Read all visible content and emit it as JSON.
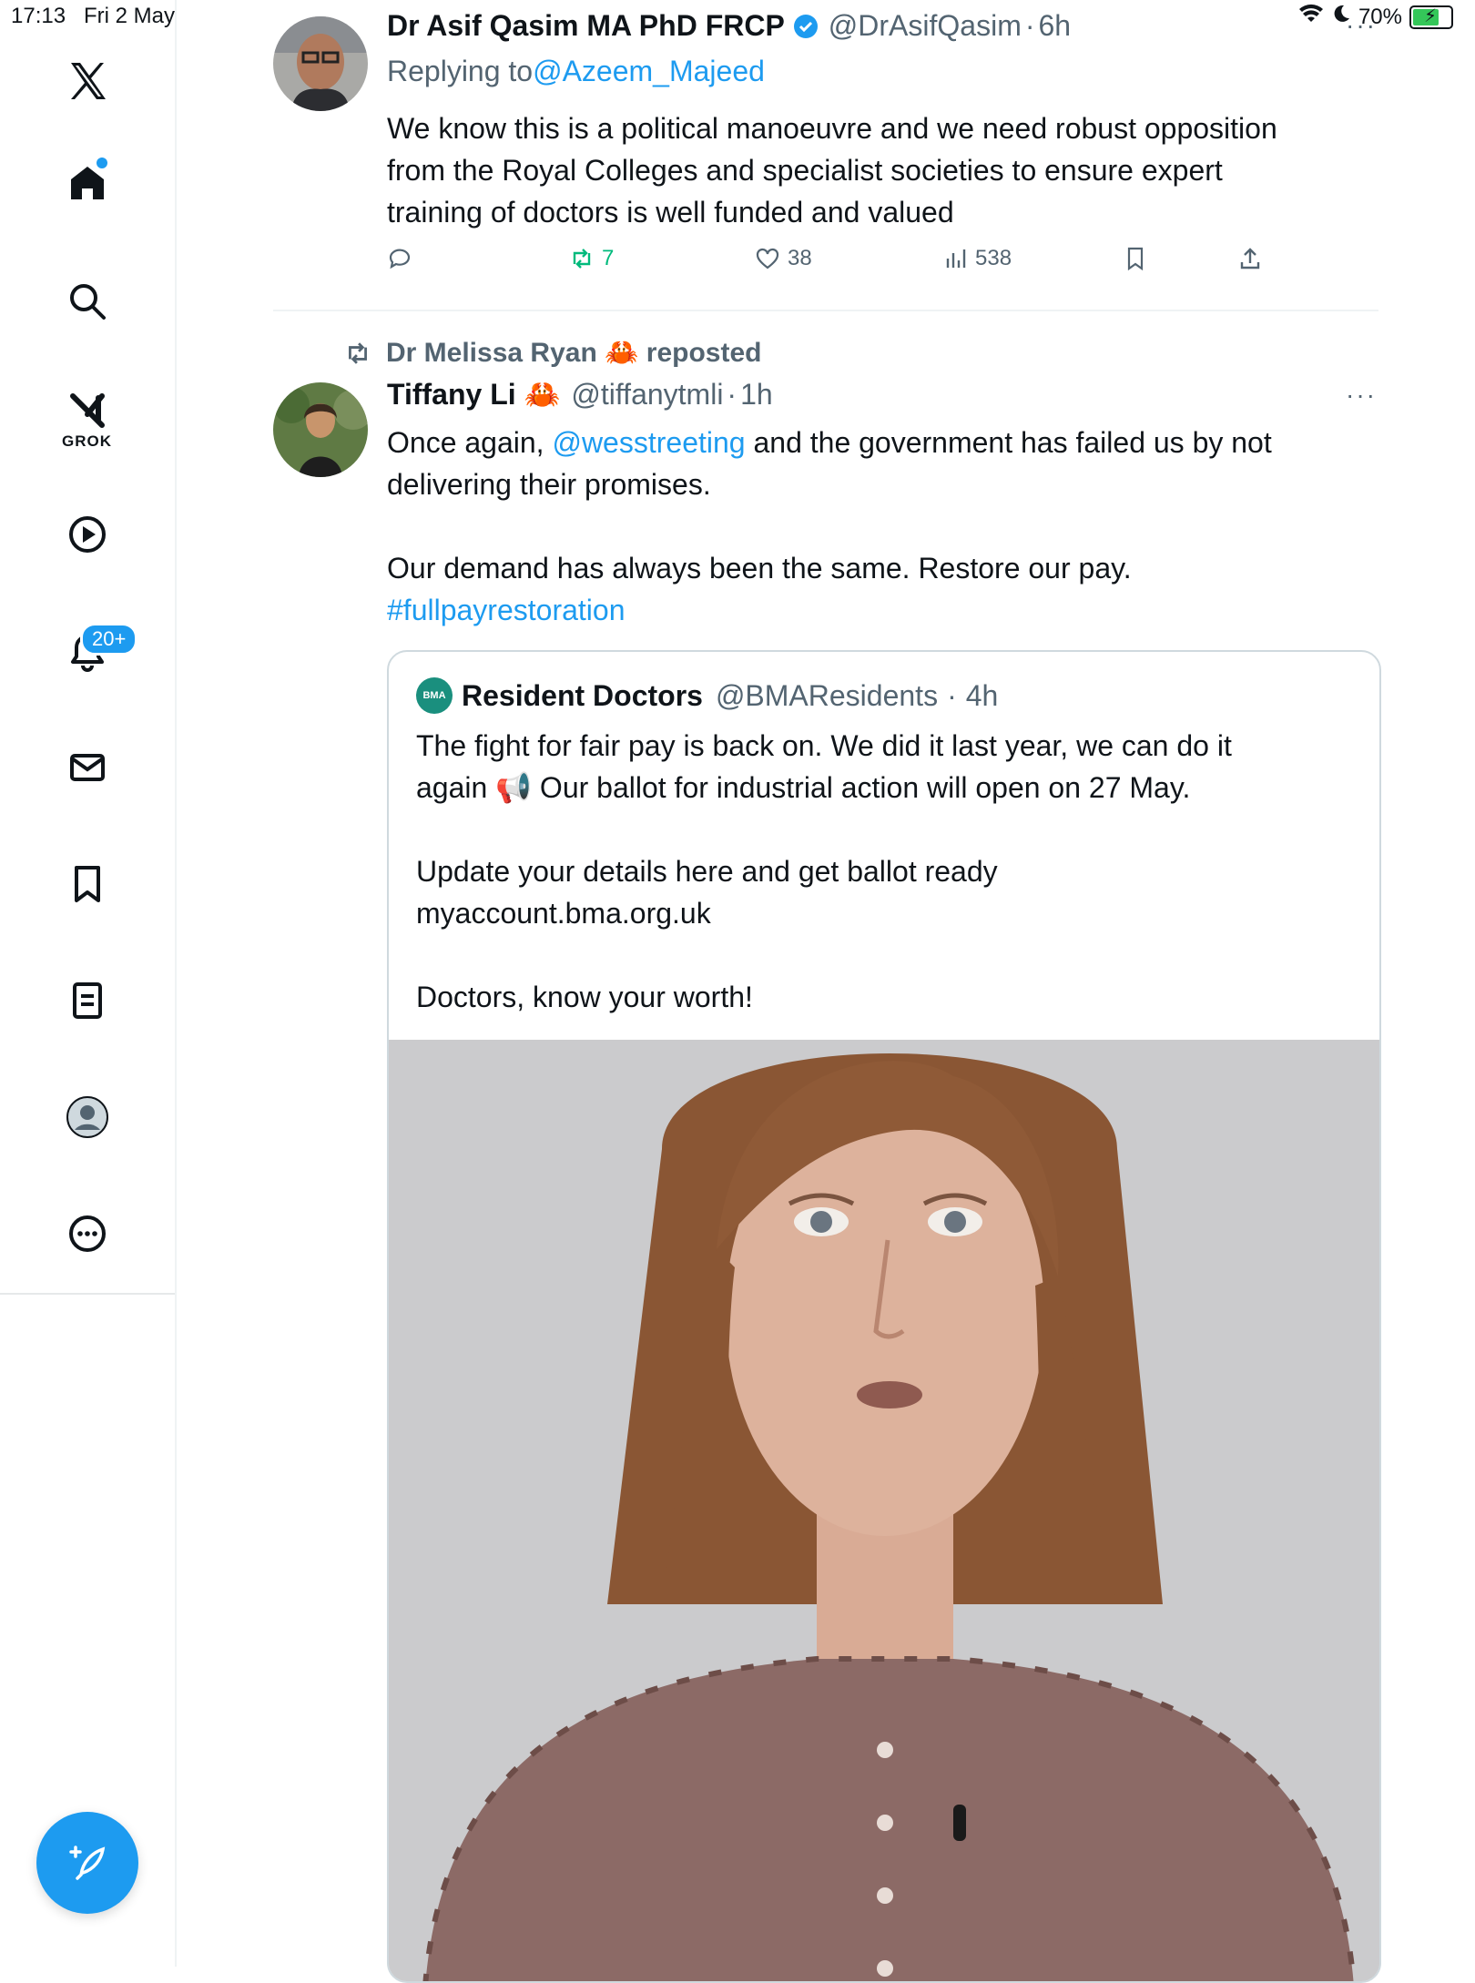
{
  "status_bar": {
    "time": "17:13",
    "date": "Fri 2 May",
    "battery": "70%"
  },
  "sidebar": {
    "grok_label": "GROK",
    "notifications_badge": "20+"
  },
  "tweet1": {
    "author_name": "Dr Asif Qasim MA PhD FRCP",
    "handle": "@DrAsifQasim",
    "time": "6h",
    "replying_prefix": "Replying to ",
    "replying_to": "@Azeem_Majeed",
    "text_lines": [
      "We know this is a political manoeuvre and we need robust opposition",
      "from the Royal Colleges and specialist societies to ensure expert",
      "training of doctors is well funded  and valued"
    ],
    "retweets": "7",
    "likes": "38",
    "views": "538"
  },
  "tweet2": {
    "reposted_by": "Dr Melissa Ryan 🦀 reposted",
    "author_name": "Tiffany Li 🦀",
    "handle": "@tiffanytmli",
    "time": "1h",
    "text_a": "Once again, ",
    "mention": "@wesstreeting",
    "text_b": " and the government has failed us by not",
    "text_line2": "delivering their promises.",
    "text_line3": "Our demand has always been the same. Restore our pay.",
    "hashtag": "#fullpayrestoration"
  },
  "quote": {
    "logo_text": "BMA",
    "author_name": "Resident Doctors",
    "handle": "@BMAResidents",
    "time": "4h",
    "line1": "The fight for fair pay is back on. We did it last year, we can do it",
    "line2": "again 📢 Our ballot for industrial action will open on 27 May.",
    "line3": "Update your details here and get ballot ready",
    "line4": "myaccount.bma.org.uk",
    "line5": "Doctors, know your worth!"
  },
  "icons": {
    "home": "home-icon",
    "search": "search-icon",
    "grok": "grok-icon",
    "video": "play-icon",
    "notifications": "bell-icon",
    "messages": "mail-icon",
    "bookmarks": "bookmark-icon",
    "lists": "list-icon",
    "profile": "profile-icon",
    "more": "more-icon",
    "compose": "compose-icon"
  },
  "colors": {
    "accent": "#1d9bf0",
    "retweet_green": "#00ba7c",
    "text_primary": "#0f1419",
    "text_secondary": "#536471"
  }
}
